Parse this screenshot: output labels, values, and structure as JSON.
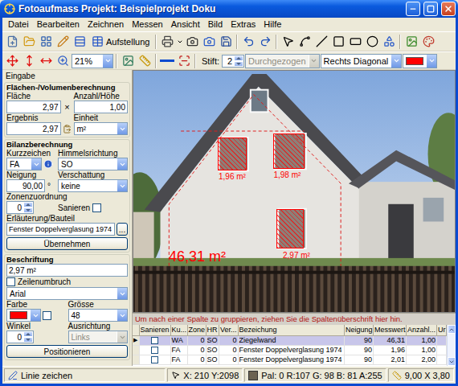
{
  "window": {
    "title": "Fotoaufmass Projekt: Beispielprojekt Doku"
  },
  "menu": [
    "Datei",
    "Bearbeiten",
    "Zeichnen",
    "Messen",
    "Ansicht",
    "Bild",
    "Extras",
    "Hilfe"
  ],
  "toolbar": {
    "report_button": "Aufstellung",
    "zoom": "21%",
    "pen_label": "Stift:",
    "pen_width": "2",
    "line_style": {
      "value": "Durchgezogen",
      "disabled": true
    },
    "hatch": {
      "value": "Rechts Diagonal",
      "disabled": false
    },
    "hatch_color": "#ff0000"
  },
  "input_panel": {
    "title": "Eingabe",
    "area": {
      "title": "Flächen-/Volumenberechnung",
      "area_label": "Fläche",
      "area_value": "2,97",
      "times": "×",
      "count_label": "Anzahl/Höhe",
      "count_value": "1,00",
      "result_label": "Ergebnis",
      "result_value": "2,97",
      "unit_label": "Einheit",
      "unit_value": "m²"
    },
    "balance": {
      "title": "Bilanzberechnung",
      "code_label": "Kurzzeichen",
      "code_value": "FA",
      "orientation_label": "Himmelsrichtung",
      "orientation_value": "SO",
      "tilt_label": "Neigung",
      "tilt_value": "90,00",
      "tilt_unit": "°",
      "shading_label": "Verschattung",
      "shading_value": "keine",
      "zone_label": "Zonenzuordnung",
      "zone_value": "0",
      "renovate": {
        "label": "Sanieren",
        "checked": false
      },
      "component_label": "Erläuterung/Bauteil",
      "component_value": "Fenster Doppelverglasung 1974",
      "browse_button": "...",
      "apply_button": "Übernehmen"
    },
    "labeling": {
      "title": "Beschriftung",
      "text_value": "2,97 m²",
      "wrap": {
        "label": "Zeilenumbruch",
        "checked": false
      },
      "font": "Arial",
      "color_label": "Farbe",
      "color": "#ff0000",
      "color_checked": false,
      "size_label": "Grösse",
      "size_value": "48",
      "angle_label": "Winkel",
      "angle_value": "0",
      "align_label": "Ausrichtung",
      "align": {
        "value": "Links",
        "disabled": true
      },
      "position_button": "Positionieren"
    }
  },
  "photo": {
    "annotations": [
      {
        "text": "46,31 m²",
        "kind": "area"
      },
      {
        "text": "1,96 m²",
        "kind": "window"
      },
      {
        "text": "1,98 m²",
        "kind": "window"
      },
      {
        "text": "2,97 m²",
        "kind": "window"
      }
    ]
  },
  "table": {
    "group_hint": "Um nach einer Spalte zu gruppieren, ziehen Sie die Spaltenüberschrift hier hin.",
    "current_marker": "▶",
    "columns": [
      "Sanieren",
      "Ku...",
      "Zone",
      "HR",
      "Ver...",
      "Bezeichung",
      "Neigung",
      "Messwert",
      "Anzahl...",
      "Ur"
    ],
    "rows": [
      {
        "selected": true,
        "renovate": false,
        "code": "WA",
        "zone": "0",
        "orientation": "SO",
        "shading": "0",
        "name": "Ziegelwand",
        "tilt": "90",
        "value": "46,31",
        "count": "1,00"
      },
      {
        "selected": false,
        "renovate": false,
        "code": "FA",
        "zone": "0",
        "orientation": "SO",
        "shading": "0",
        "name": "Fenster Doppelverglasung 1974",
        "tilt": "90",
        "value": "1,96",
        "count": "1,00"
      },
      {
        "selected": false,
        "renovate": false,
        "code": "FA",
        "zone": "0",
        "orientation": "SO",
        "shading": "0",
        "name": "Fenster Doppelverglasung 1974",
        "tilt": "90",
        "value": "2,01",
        "count": "2,00"
      }
    ]
  },
  "status_bar": {
    "hint": "Linie zeichen",
    "coords": "X: 210 Y:2098",
    "pixel": "Pal: 0 R:107 G: 98 B: 81 A:255",
    "pixel_color": "#6b6251",
    "size": "9,00 X 3,80"
  }
}
